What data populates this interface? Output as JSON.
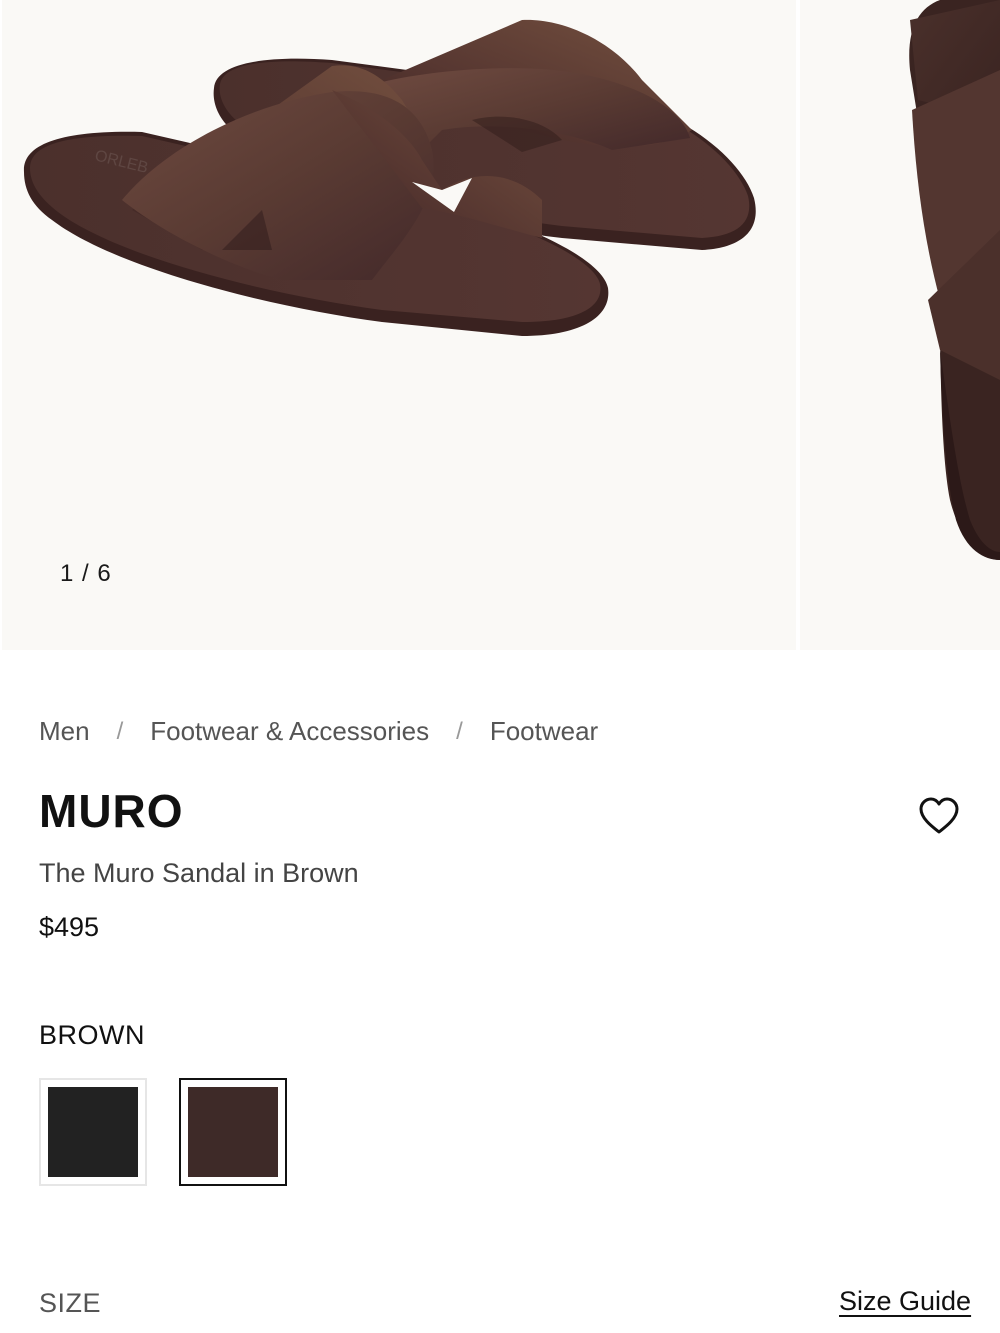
{
  "gallery": {
    "counter": "1 / 6",
    "current_slide": 1,
    "total_slides": 6
  },
  "breadcrumb": {
    "items": [
      "Men",
      "Footwear & Accessories",
      "Footwear"
    ],
    "separator": "/"
  },
  "product": {
    "name": "MURO",
    "subtitle": "The Muro Sandal in Brown",
    "price": "$495",
    "selected_color": "BROWN",
    "swatches": [
      {
        "name": "black",
        "color": "#222222",
        "selected": false
      },
      {
        "name": "brown",
        "color": "#3e2a28",
        "selected": true
      }
    ]
  },
  "size": {
    "label": "SIZE",
    "guide_label": "Size Guide"
  },
  "icons": {
    "wishlist": "heart-outline-icon"
  },
  "colors": {
    "image_background": "#faf9f6",
    "leather": "#5a3b33"
  }
}
